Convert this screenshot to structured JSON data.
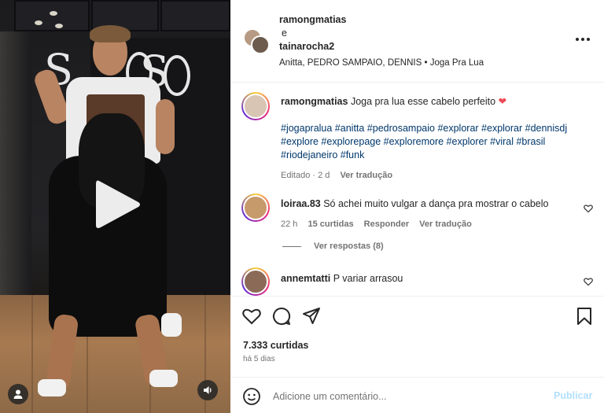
{
  "post": {
    "author_primary": "ramongmatias",
    "and_word": "e",
    "author_secondary": "tainarocha2",
    "music": "Anitta, PEDRO SAMPAIO, DENNIS • Joga Pra Lua",
    "more_icon": "more-horizontal-icon"
  },
  "caption": {
    "username": "ramongmatias",
    "text": "Joga pra lua esse cabelo perfeito",
    "heart": "❤",
    "hashtags": "#jogapralua #anitta #pedrosampaio #explorar #explorar #dennisdj #explore #explorepage #exploremore #explorer #viral #brasil #riodejaneiro #funk",
    "edited": "Editado · 2 d",
    "translate": "Ver tradução"
  },
  "comments": [
    {
      "username": "loiraa.83",
      "text": "Só achei muito vulgar a dança pra mostrar o cabelo",
      "time": "22 h",
      "likes": "15 curtidas",
      "reply": "Responder",
      "translate": "Ver tradução",
      "view_replies": "Ver respostas (8)"
    },
    {
      "username": "annemtatti",
      "text": "P variar arrasou"
    }
  ],
  "actions": {
    "likes": "7.333 curtidas",
    "time_ago": "há 5 dias"
  },
  "comment_box": {
    "placeholder": "Adicione um comentário...",
    "publish": "Publicar"
  },
  "colors": {
    "link": "#00376b",
    "muted": "#737373",
    "publish_disabled": "#b2dffc",
    "heart": "#ed4956"
  }
}
